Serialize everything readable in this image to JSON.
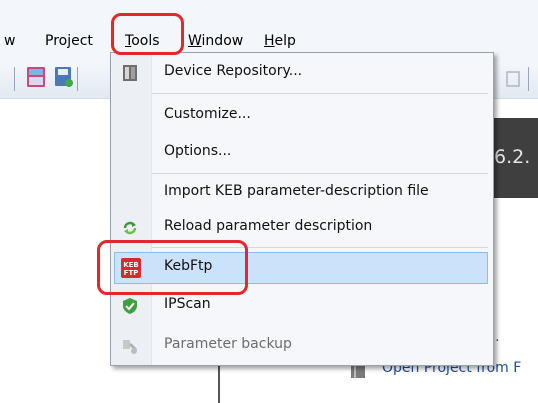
{
  "menubar": {
    "items": [
      {
        "label": "w",
        "accel": ""
      },
      {
        "label": "Project",
        "accel": ""
      },
      {
        "label": "Tools",
        "accel": "T"
      },
      {
        "label": "Window",
        "accel": "W"
      },
      {
        "label": "Help",
        "accel": "H"
      }
    ]
  },
  "tools_menu": {
    "items": [
      {
        "label": "Device Repository...",
        "icon": "device-repository-icon"
      },
      {
        "label": "Customize...",
        "icon": ""
      },
      {
        "label": "Options...",
        "icon": ""
      },
      {
        "label": "Import KEB parameter-description file",
        "icon": ""
      },
      {
        "label": "Reload parameter description",
        "icon": "reload-icon"
      },
      {
        "label": "KebFtp",
        "icon": "keb-ftp-icon"
      },
      {
        "label": "IPScan",
        "icon": "ipscan-shield-icon"
      },
      {
        "label": "Parameter backup",
        "icon": "parameter-backup-icon"
      }
    ],
    "selected": "KebFtp",
    "disabled": "Parameter backup"
  },
  "background": {
    "version_text": "6.2.",
    "open_project_link": "Open Project from F",
    "ellipsis": "..."
  },
  "icons": {
    "keb_line1": "KEB",
    "keb_line2": "FTP"
  },
  "colors": {
    "highlight": "#cbe3fa",
    "annotation": "#e5262a",
    "link": "#1f4fa3"
  }
}
